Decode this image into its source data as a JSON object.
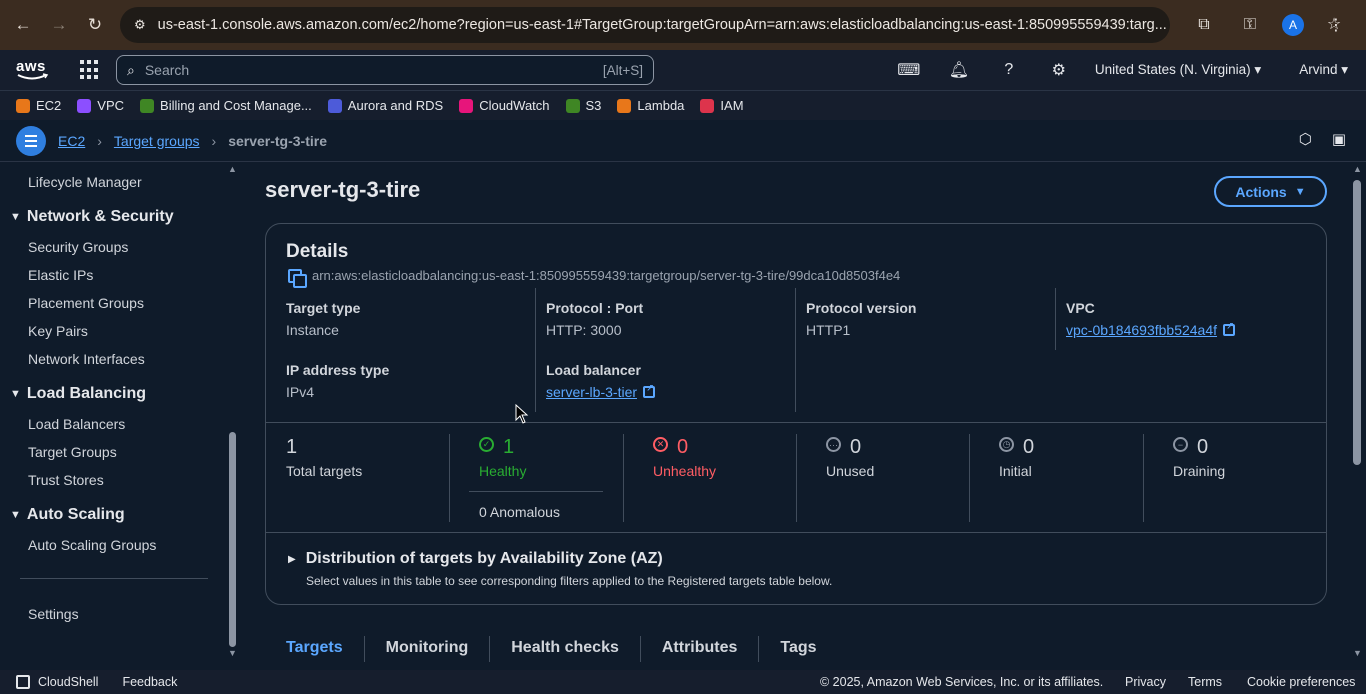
{
  "browser": {
    "url": "us-east-1.console.aws.amazon.com/ec2/home?region=us-east-1#TargetGroup:targetGroupArn=arn:aws:elasticloadbalancing:us-east-1:850995559439:targ...",
    "avatar_letter": "A"
  },
  "aws_nav": {
    "logo_text": "aws",
    "search_placeholder": "Search",
    "search_shortcut": "[Alt+S]",
    "region": "United States (N. Virginia) ▾",
    "user": "Arvind ▾"
  },
  "favorites": [
    {
      "label": "EC2",
      "color": "#e8771a"
    },
    {
      "label": "VPC",
      "color": "#8c4fff"
    },
    {
      "label": "Billing and Cost Manage...",
      "color": "#3f8624"
    },
    {
      "label": "Aurora and RDS",
      "color": "#4d5bd9"
    },
    {
      "label": "CloudWatch",
      "color": "#e7157b"
    },
    {
      "label": "S3",
      "color": "#3f8624"
    },
    {
      "label": "Lambda",
      "color": "#e8771a"
    },
    {
      "label": "IAM",
      "color": "#dd344c"
    }
  ],
  "breadcrumb": {
    "items": [
      "EC2",
      "Target groups"
    ],
    "current": "server-tg-3-tire"
  },
  "sidebar": {
    "top_item": "Lifecycle Manager",
    "sections": [
      {
        "title": "Network & Security",
        "items": [
          "Security Groups",
          "Elastic IPs",
          "Placement Groups",
          "Key Pairs",
          "Network Interfaces"
        ]
      },
      {
        "title": "Load Balancing",
        "items": [
          "Load Balancers",
          "Target Groups",
          "Trust Stores"
        ]
      },
      {
        "title": "Auto Scaling",
        "items": [
          "Auto Scaling Groups"
        ]
      }
    ],
    "settings": "Settings"
  },
  "page": {
    "title": "server-tg-3-tire",
    "actions_label": "Actions"
  },
  "details": {
    "title": "Details",
    "arn": "arn:aws:elasticloadbalancing:us-east-1:850995559439:targetgroup/server-tg-3-tire/99dca10d8503f4e4",
    "target_type_label": "Target type",
    "target_type_value": "Instance",
    "protocol_port_label": "Protocol : Port",
    "protocol_port_value": "HTTP: 3000",
    "protocol_version_label": "Protocol version",
    "protocol_version_value": "HTTP1",
    "vpc_label": "VPC",
    "vpc_value": "vpc-0b184693fbb524a4f",
    "ip_type_label": "IP address type",
    "ip_type_value": "IPv4",
    "lb_label": "Load balancer",
    "lb_value": "server-lb-3-tier"
  },
  "stats": {
    "total": {
      "value": "1",
      "label": "Total targets"
    },
    "healthy": {
      "value": "1",
      "label": "Healthy",
      "color": "#29ad32"
    },
    "anomalous": "0 Anomalous",
    "unhealthy": {
      "value": "0",
      "label": "Unhealthy",
      "color": "#ff5d64"
    },
    "unused": {
      "value": "0",
      "label": "Unused"
    },
    "initial": {
      "value": "0",
      "label": "Initial"
    },
    "draining": {
      "value": "0",
      "label": "Draining"
    }
  },
  "az": {
    "title": "Distribution of targets by Availability Zone (AZ)",
    "description": "Select values in this table to see corresponding filters applied to the Registered targets table below."
  },
  "tabs": [
    "Targets",
    "Monitoring",
    "Health checks",
    "Attributes",
    "Tags"
  ],
  "footer": {
    "cloudshell": "CloudShell",
    "feedback": "Feedback",
    "copyright": "© 2025, Amazon Web Services, Inc. or its affiliates.",
    "privacy": "Privacy",
    "terms": "Terms",
    "cookies": "Cookie preferences"
  }
}
